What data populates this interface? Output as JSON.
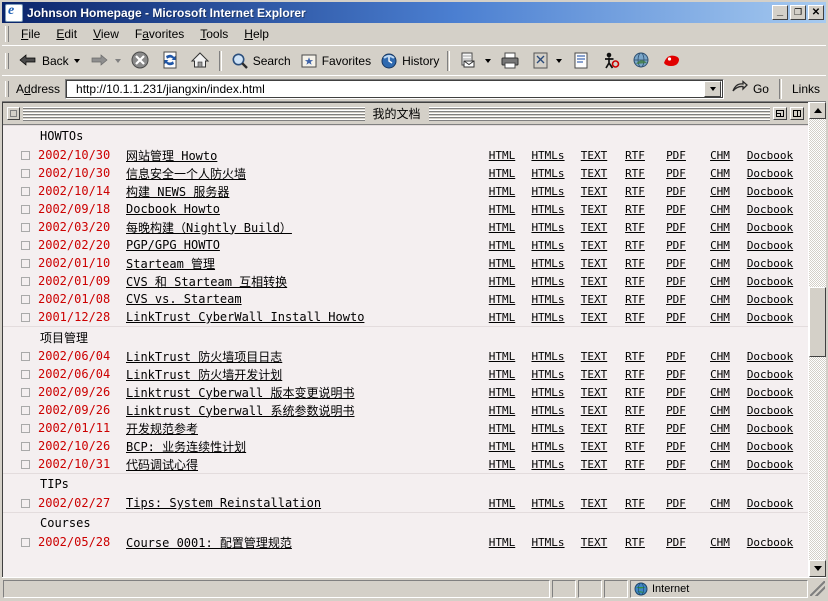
{
  "window": {
    "title": "Johnson Homepage - Microsoft Internet Explorer",
    "app_icon": "ie-document-icon",
    "minimize_label": "_",
    "maximize_label": "□",
    "close_label": "✕"
  },
  "menu": {
    "items": [
      {
        "name": "file",
        "pre": "F",
        "accel": "",
        "label": "File",
        "a": "F",
        "rest": "ile"
      },
      {
        "name": "edit",
        "a": "E",
        "rest": "dit"
      },
      {
        "name": "view",
        "a": "V",
        "rest": "iew"
      },
      {
        "name": "favorites",
        "pre": "F",
        "a": "a",
        "rest": "vorites",
        "lead": "F"
      },
      {
        "name": "tools",
        "a": "T",
        "rest": "ools"
      },
      {
        "name": "help",
        "a": "H",
        "rest": "elp"
      }
    ]
  },
  "toolbar": {
    "back_label": "Back",
    "forward_label": "",
    "stop_label": "",
    "refresh_label": "",
    "home_label": "",
    "search_label": "Search",
    "favorites_label": "Favorites",
    "history_label": "History",
    "mail_label": "",
    "print_label": "",
    "edit_label": "",
    "discuss_label": "",
    "messenger_label": "",
    "realplayer_label": ""
  },
  "address_bar": {
    "label": "Address",
    "url": "http://10.1.1.231/jiangxin/index.html",
    "go_label": "Go",
    "links_label": "Links"
  },
  "page": {
    "doc_title": "我的文档",
    "columns": [
      "HTML",
      "HTMLs",
      "TEXT",
      "RTF",
      "PDF",
      "CHM",
      "Docbook"
    ],
    "sections": [
      {
        "name": "HOWTOs",
        "title": "HOWTOs",
        "rows": [
          {
            "date": "2002/10/30",
            "title": "网站管理 Howto"
          },
          {
            "date": "2002/10/30",
            "title": "信息安全一个人防火墙"
          },
          {
            "date": "2002/10/14",
            "title": "构建 NEWS 服务器"
          },
          {
            "date": "2002/09/18",
            "title": "Docbook Howto"
          },
          {
            "date": "2002/03/20",
            "title": "每晚构建（Nightly Build）"
          },
          {
            "date": "2002/02/20",
            "title": "PGP/GPG HOWTO"
          },
          {
            "date": "2002/01/10",
            "title": "Starteam 管理"
          },
          {
            "date": "2002/01/09",
            "title": "CVS 和 Starteam 互相转换"
          },
          {
            "date": "2002/01/08",
            "title": "CVS vs. Starteam"
          },
          {
            "date": "2001/12/28",
            "title": "LinkTrust CyberWall Install Howto"
          }
        ]
      },
      {
        "name": "project-management",
        "title": "项目管理",
        "rows": [
          {
            "date": "2002/06/04",
            "title": "LinkTrust 防火墙项目日志"
          },
          {
            "date": "2002/06/04",
            "title": "LinkTrust 防火墙开发计划"
          },
          {
            "date": "2002/09/26",
            "title": "Linktrust Cyberwall 版本变更说明书"
          },
          {
            "date": "2002/09/26",
            "title": "Linktrust Cyberwall 系统参数说明书"
          },
          {
            "date": "2002/01/11",
            "title": "开发规范参考"
          },
          {
            "date": "2002/10/26",
            "title": "BCP: 业务连续性计划"
          },
          {
            "date": "2002/10/31",
            "title": "代码调试心得"
          }
        ]
      },
      {
        "name": "tips",
        "title": "TIPs",
        "rows": [
          {
            "date": "2002/02/27",
            "title": "Tips: System Reinstallation"
          }
        ]
      },
      {
        "name": "courses",
        "title": "Courses",
        "rows": [
          {
            "date": "2002/05/28",
            "title": "Course 0001: 配置管理规范"
          }
        ]
      }
    ]
  },
  "status_bar": {
    "message": "",
    "zone": "Internet"
  },
  "colors": {
    "date_red": "#cc0000",
    "page_bg": "#f4eff0",
    "chrome": "#d4d0c8",
    "title_blue": "#0a246a"
  }
}
